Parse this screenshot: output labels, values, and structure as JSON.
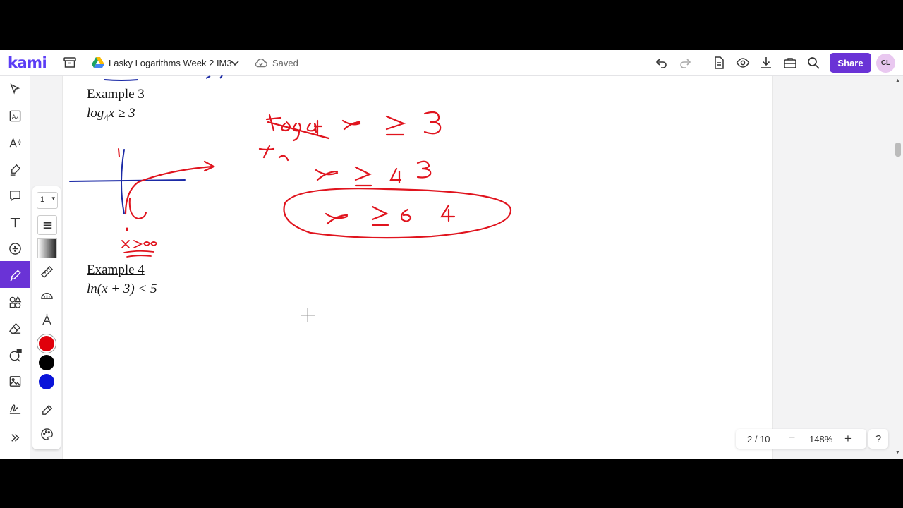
{
  "app": {
    "logo": "kami",
    "doc_title": "Lasky Logarithms Week 2 IM3",
    "save_status": "Saved",
    "share_label": "Share",
    "avatar_initials": "CL"
  },
  "palette": {
    "stroke_width": "1",
    "colors": [
      "#e0000b",
      "#000000",
      "#0a14d9"
    ]
  },
  "document": {
    "example3": {
      "heading": "Example 3",
      "eq_before": "log",
      "eq_sub": "4",
      "eq_after": "x ≥ 3"
    },
    "example4": {
      "heading": "Example 4",
      "eq": "ln(x + 3) < 5"
    }
  },
  "ink_colors": {
    "red": "#e0141e",
    "blue": "#1b2aa6"
  },
  "pagenav": {
    "page": "2 / 10",
    "zoom": "148%",
    "minus": "−",
    "plus": "+"
  },
  "help_label": "?"
}
